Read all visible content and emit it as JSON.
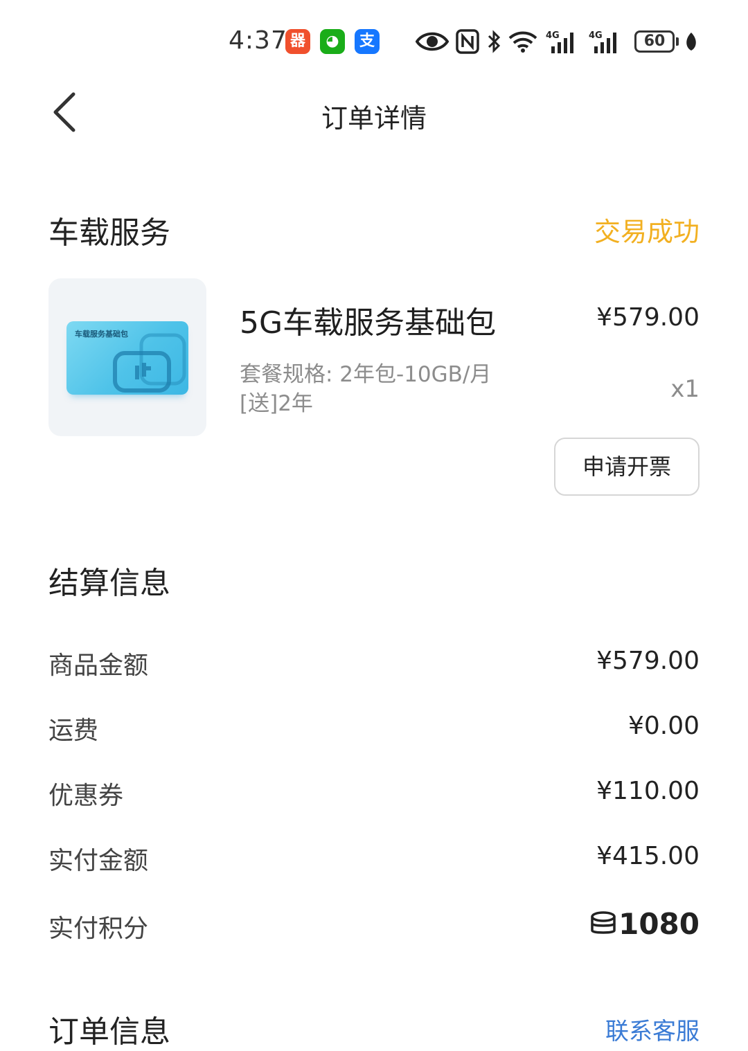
{
  "status_bar": {
    "time": "4:37",
    "apps": [
      {
        "name": "app-red-icon",
        "glyph": "器",
        "color": "#F0502D"
      },
      {
        "name": "wechat-icon",
        "glyph": "◕",
        "color": "#1AAD19"
      },
      {
        "name": "alipay-icon",
        "glyph": "支",
        "color": "#1677FF"
      }
    ],
    "battery_level": "60"
  },
  "nav": {
    "title": "订单详情"
  },
  "service": {
    "section_title": "车载服务",
    "order_status": "交易成功",
    "status_color": "#F2B021",
    "product": {
      "card_label": "车载服务基础包",
      "name": "5G车载服务基础包",
      "price": "¥579.00",
      "spec": "套餐规格: 2年包-10GB/月[送]2年",
      "quantity": "x1"
    },
    "invoice_button": "申请开票"
  },
  "settlement": {
    "section_title": "结算信息",
    "rows": [
      {
        "label": "商品金额",
        "value": "¥579.00"
      },
      {
        "label": "运费",
        "value": "¥0.00"
      },
      {
        "label": "优惠券",
        "value": "¥110.00"
      },
      {
        "label": "实付金额",
        "value": "¥415.00"
      }
    ],
    "points_label": "实付积分",
    "points_value": "1080"
  },
  "order_info": {
    "section_title": "订单信息",
    "contact_link": "联系客服",
    "link_color": "#3A7BD5"
  }
}
